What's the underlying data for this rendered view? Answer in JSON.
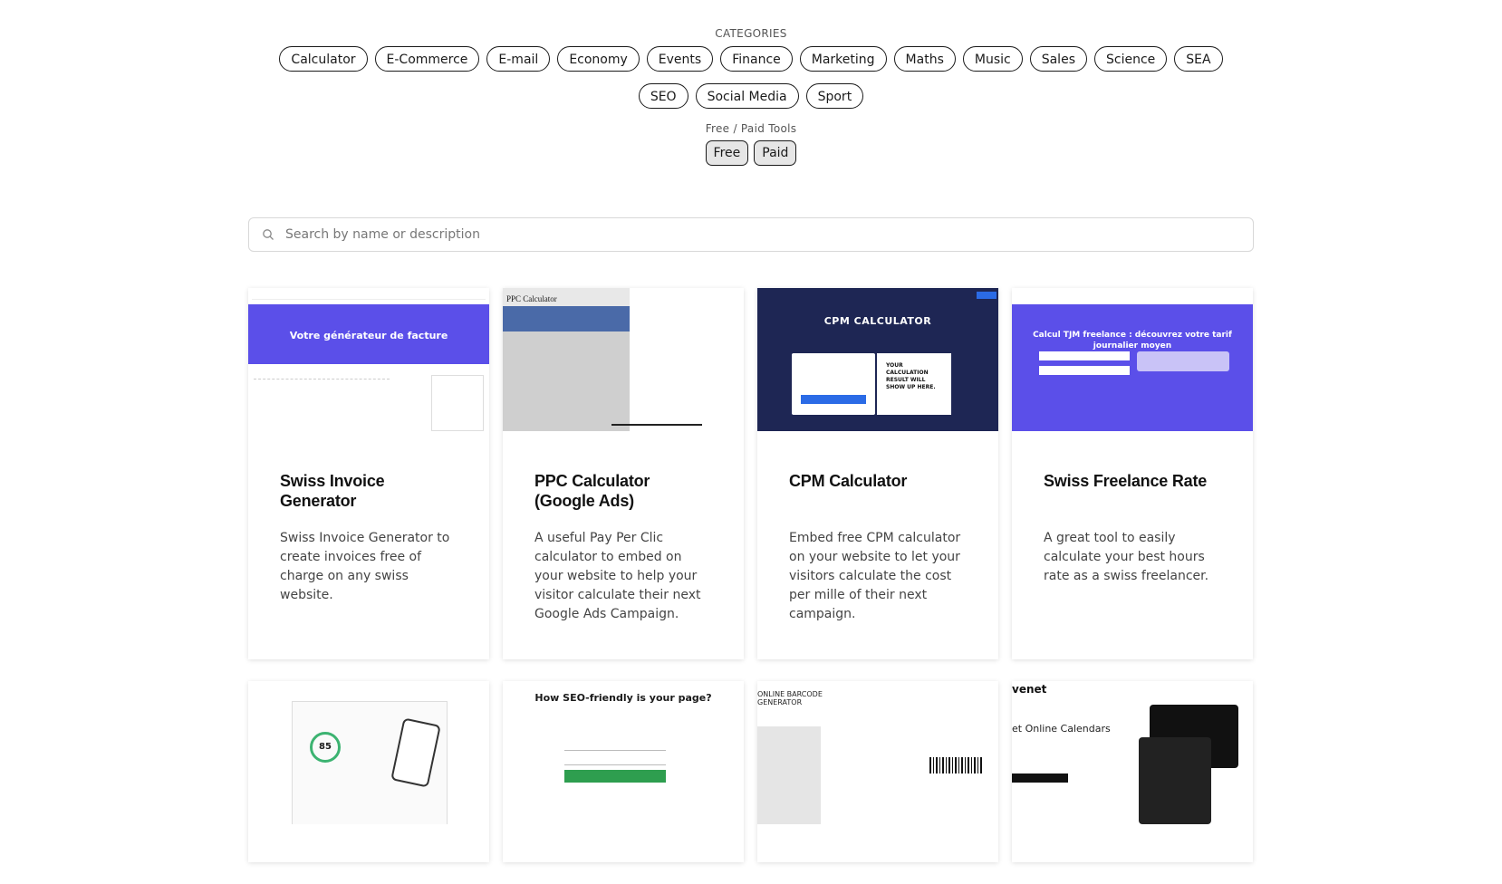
{
  "filters": {
    "categories_label": "CATEGORIES",
    "categories": [
      "Calculator",
      "E-Commerce",
      "E-mail",
      "Economy",
      "Events",
      "Finance",
      "Marketing",
      "Maths",
      "Music",
      "Sales",
      "Science",
      "SEA",
      "SEO",
      "Social Media",
      "Sport"
    ],
    "price_label": "Free / Paid Tools",
    "price_options": [
      "Free",
      "Paid"
    ]
  },
  "search": {
    "placeholder": "Search by name or description"
  },
  "cards": [
    {
      "title": "Swiss Invoice Generator",
      "description": "Swiss Invoice Generator to create invoices free of charge on any swiss website.",
      "thumb_text": "Votre générateur de facture"
    },
    {
      "title": "PPC Calculator (Google Ads)",
      "description": "A useful Pay Per Clic calculator to embed on your website to help your visitor calculate their next Google Ads Campaign.",
      "thumb_text": "PPC Calculator"
    },
    {
      "title": "CPM Calculator",
      "description": "Embed free CPM calculator on your website to let your visitors calculate the cost per mille of their next campaign.",
      "thumb_text": "CPM CALCULATOR",
      "thumb_result": "YOUR CALCULATION RESULT WILL SHOW UP HERE."
    },
    {
      "title": "Swiss Freelance Rate",
      "description": "A great tool to easily calculate your best hours rate as a swiss freelancer.",
      "thumb_text": "Calcul TJM freelance : découvrez votre tarif journalier moyen"
    },
    {
      "title": "",
      "description": "",
      "thumb_text": "85"
    },
    {
      "title": "",
      "description": "",
      "thumb_text": "How SEO-friendly is your page?"
    },
    {
      "title": "",
      "description": "",
      "thumb_text": "ONLINE BARCODE GENERATOR"
    },
    {
      "title": "",
      "description": "",
      "thumb_text": "venet",
      "thumb_sub": "et Online Calendars"
    }
  ]
}
